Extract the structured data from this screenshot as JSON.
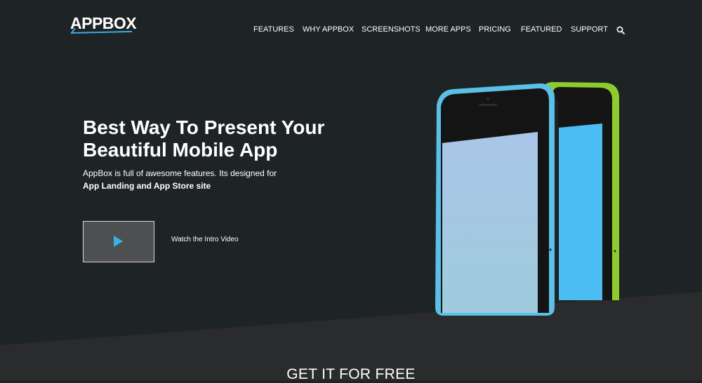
{
  "brand": {
    "logo_text": "APPBOX"
  },
  "nav": {
    "items": [
      "FEATURES",
      "WHY APPBOX",
      "SCREENSHOTS",
      "MORE APPS",
      "PRICING",
      "FEATURED",
      "SUPPORT"
    ],
    "search_icon": "search-icon"
  },
  "hero": {
    "title": "Best Way To Present Your Beautiful Mobile App",
    "description": "AppBox is full of awesome features. Its designed for",
    "description_strong": "App Landing and App Store site",
    "video_label": "Watch the Intro Video",
    "video_icon": "play-icon"
  },
  "cta": {
    "heading": "GET IT FOR FREE"
  },
  "colors": {
    "background": "#1e2326",
    "lower_band": "#2a2b2c",
    "accent": "#3ab1e6",
    "phone_blue": "#5bbfe8",
    "phone_green": "#8fcb2e"
  }
}
